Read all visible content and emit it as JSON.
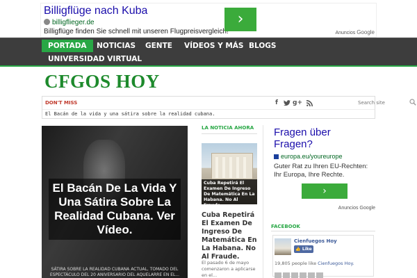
{
  "top_ad": {
    "title": "Billigflüge nach Kuba",
    "domain": "billigflieger.de",
    "description": "Billigflüge finden Sie schnell mit unseren Flugpreisvergleich!",
    "arrow": "›",
    "brand_prefix": "Anuncios",
    "brand": "Google"
  },
  "nav": {
    "items": [
      {
        "label": "PORTADA",
        "active": true
      },
      {
        "label": "NOTICIAS"
      },
      {
        "label": "GENTE"
      },
      {
        "label": "VÍDEOS Y MÁS"
      },
      {
        "label": "BLOGS"
      },
      {
        "label": "UNIVERSIDAD VIRTUAL"
      }
    ]
  },
  "logo": "CFGOS HOY",
  "dont_miss": {
    "label": "DON'T MISS",
    "ticker": "El Bacán de la vida y una sátira sobre la realidad cubana.",
    "social": [
      "f",
      "t",
      "g+",
      "rss"
    ],
    "search_placeholder": "Search site"
  },
  "feature": {
    "title": "El Bacán De La Vida Y Una Sátira Sobre La Realidad Cubana. Ver Vídeo.",
    "subtitle": "SÁTIRA SOBRE LA REALIDAD CUBANA ACTUAL, TOMADO DEL ESPECTÁCULO DEL 20 ANIVERSARIO DEL AQUELARRE EN EL..."
  },
  "noticia": {
    "header": "LA NOTICIA AHORA",
    "caption": "Cuba Repetirá El Examen De Ingreso De Matemática En La Habana. No Al Fraude.",
    "title": "Cuba Repetirá El Examen De Ingreso De Matemática En La Habana. No Al Fraude.",
    "excerpt": "El pasado 6 de mayo comenzaron a aplicarse en el..."
  },
  "side_ad": {
    "headline": "Fragen über Fragen?",
    "domain": "europa.eu/youreurope",
    "text": "Guter Rat zu Ihren EU-Rechten: Ihr Europa, Ihre Rechte.",
    "arrow": "›",
    "brand_prefix": "Anuncios",
    "brand": "Google"
  },
  "facebook": {
    "header": "FACEBOOK",
    "page_name": "Cienfuegos Hoy",
    "like_label": "Like",
    "count": "19,805",
    "count_text": "people like",
    "count_link": "Cienfuegos Hoy."
  }
}
